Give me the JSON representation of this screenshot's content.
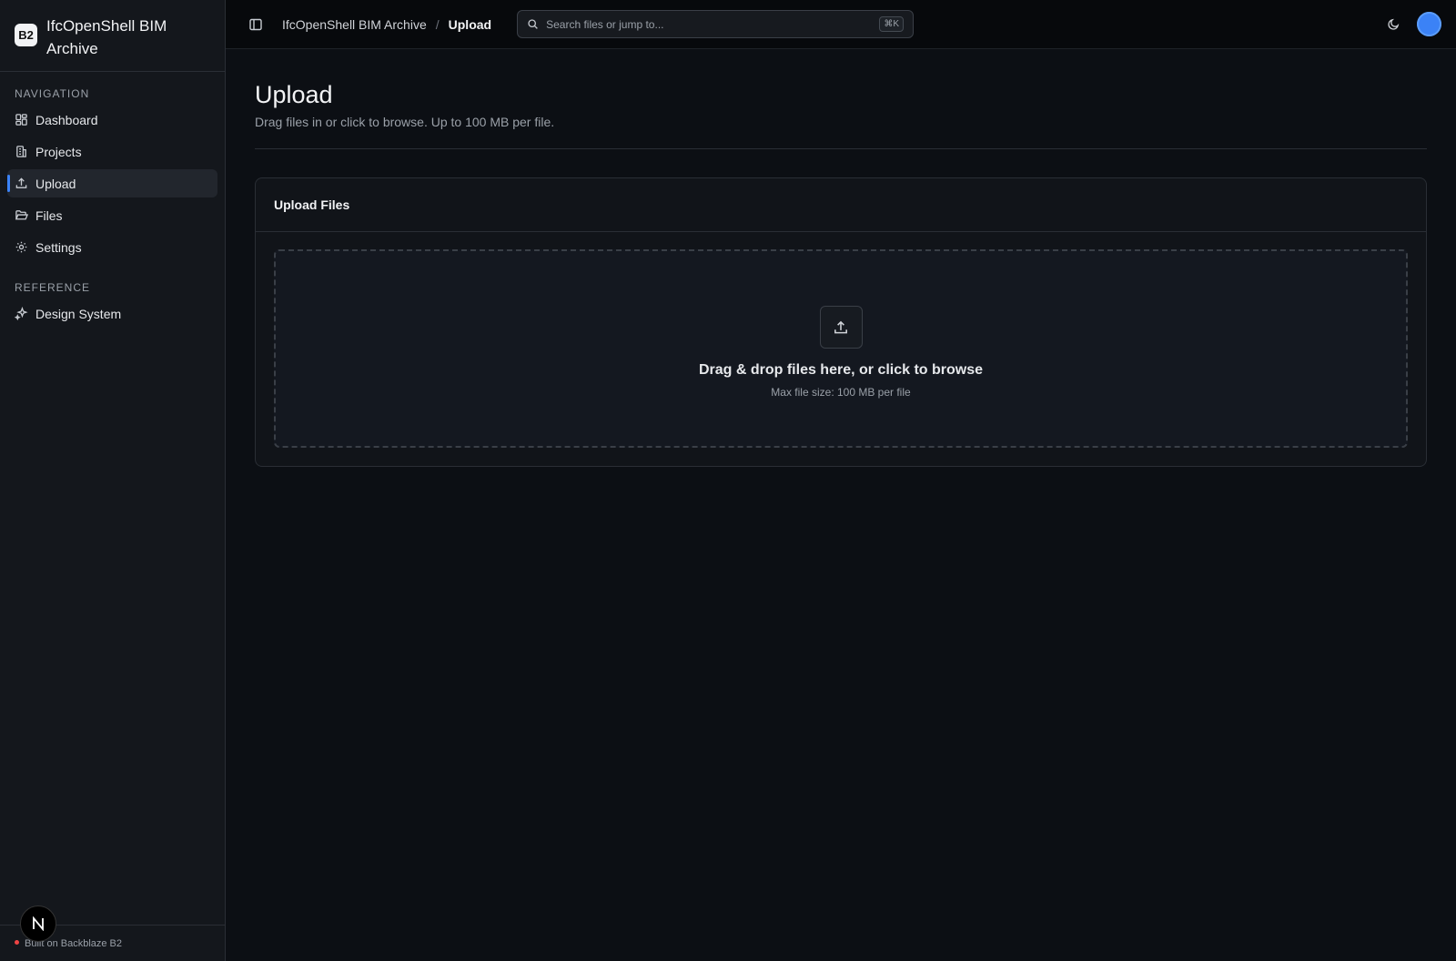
{
  "brand": {
    "logo": "B2",
    "name": "IfcOpenShell BIM Archive"
  },
  "sidebar": {
    "nav_label": "NAVIGATION",
    "nav_items": [
      {
        "label": "Dashboard",
        "icon": "dashboard-icon"
      },
      {
        "label": "Projects",
        "icon": "building-icon"
      },
      {
        "label": "Upload",
        "icon": "upload-icon",
        "active": true
      },
      {
        "label": "Files",
        "icon": "folder-open-icon"
      },
      {
        "label": "Settings",
        "icon": "gear-icon"
      }
    ],
    "ref_label": "REFERENCE",
    "ref_items": [
      {
        "label": "Design System",
        "icon": "sparkles-icon"
      }
    ],
    "footer": "Built on Backblaze B2",
    "n_badge": "N"
  },
  "topbar": {
    "breadcrumb_root": "IfcOpenShell BIM Archive",
    "breadcrumb_sep": "/",
    "breadcrumb_current": "Upload",
    "search_placeholder": "Search files or jump to...",
    "search_shortcut": "⌘K"
  },
  "page": {
    "title": "Upload",
    "subtitle": "Drag files in or click to browse. Up to 100 MB per file."
  },
  "card": {
    "title": "Upload Files",
    "drop_title": "Drag & drop files here, or click to browse",
    "drop_sub": "Max file size: 100 MB per file"
  },
  "colors": {
    "accent": "#3b82f6",
    "status": "#ef4444"
  }
}
